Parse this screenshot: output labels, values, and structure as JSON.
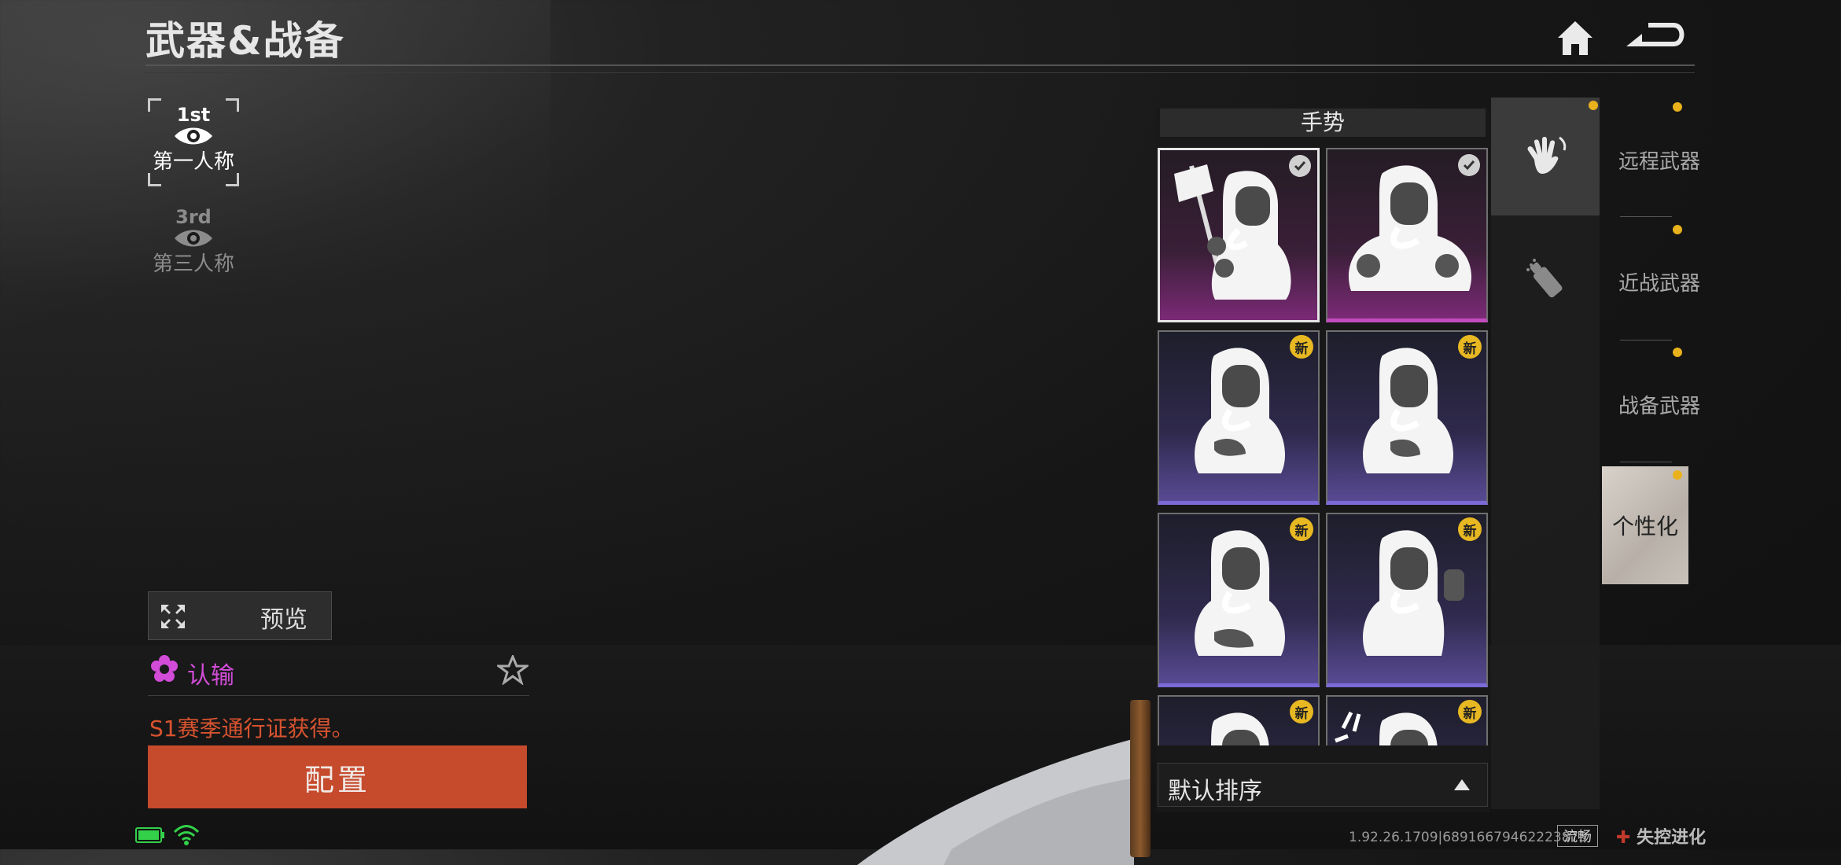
{
  "header": {
    "title": "武器&战备"
  },
  "view_modes": [
    {
      "ordinal": "1st",
      "label": "第一人称",
      "active": true
    },
    {
      "ordinal": "3rd",
      "label": "第三人称",
      "active": false
    }
  ],
  "preview": {
    "label": "预览"
  },
  "emote": {
    "name": "认输",
    "source": "S1赛季通行证获得。"
  },
  "config_button": "配置",
  "gesture_panel": {
    "title": "手势",
    "badge_new": "新",
    "cards": [
      {
        "rarity": "pink",
        "selected": true,
        "badge": "check"
      },
      {
        "rarity": "pink",
        "selected": false,
        "badge": "check"
      },
      {
        "rarity": "purple",
        "selected": false,
        "badge": "new"
      },
      {
        "rarity": "purple",
        "selected": false,
        "badge": "new"
      },
      {
        "rarity": "purple",
        "selected": false,
        "badge": "new"
      },
      {
        "rarity": "purple",
        "selected": false,
        "badge": "new"
      },
      {
        "rarity": "purple",
        "selected": false,
        "badge": "new"
      },
      {
        "rarity": "purple",
        "selected": false,
        "badge": "new"
      }
    ],
    "sort_label": "默认排序"
  },
  "category_icons": [
    {
      "name": "wave-hand-icon",
      "active": true
    },
    {
      "name": "spray-can-icon",
      "active": false
    }
  ],
  "right_tabs": [
    {
      "label": "远程武器"
    },
    {
      "label": "近战武器"
    },
    {
      "label": "战备武器"
    },
    {
      "label": "个性化",
      "active": true
    }
  ],
  "footer": {
    "version": "1.92.26.1709|68916679462223875",
    "quality": "流畅",
    "brand": "失控进化"
  },
  "colors": {
    "accent_orange": "#c64a2c",
    "emote_pink": "#d24cd8",
    "badge_gold": "#e8b823",
    "dot_gold": "#e9b21c"
  }
}
